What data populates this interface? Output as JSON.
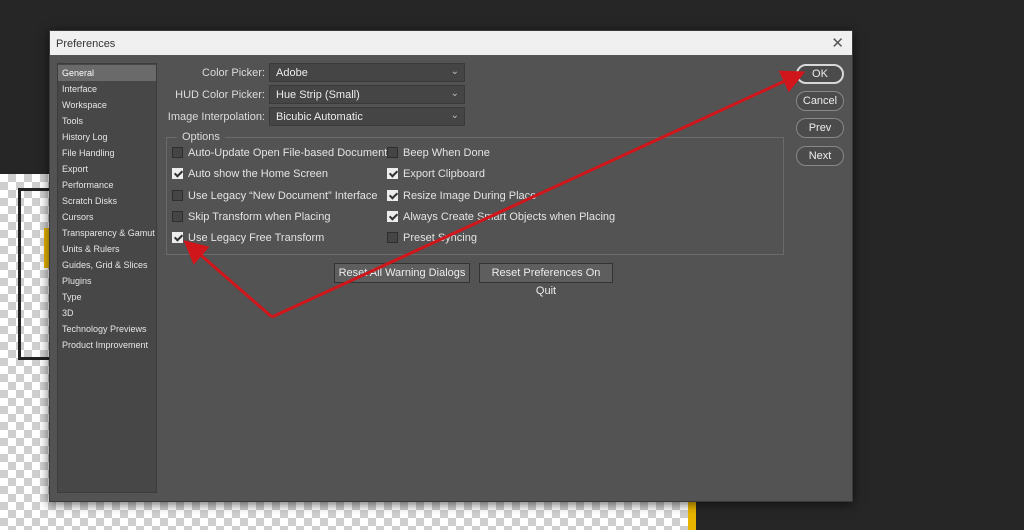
{
  "window": {
    "title": "Preferences"
  },
  "sidebar": {
    "items": [
      {
        "label": "General"
      },
      {
        "label": "Interface"
      },
      {
        "label": "Workspace"
      },
      {
        "label": "Tools"
      },
      {
        "label": "History Log"
      },
      {
        "label": "File Handling"
      },
      {
        "label": "Export"
      },
      {
        "label": "Performance"
      },
      {
        "label": "Scratch Disks"
      },
      {
        "label": "Cursors"
      },
      {
        "label": "Transparency & Gamut"
      },
      {
        "label": "Units & Rulers"
      },
      {
        "label": "Guides, Grid & Slices"
      },
      {
        "label": "Plugins"
      },
      {
        "label": "Type"
      },
      {
        "label": "3D"
      },
      {
        "label": "Technology Previews"
      },
      {
        "label": "Product Improvement"
      }
    ]
  },
  "fields": {
    "color_picker": {
      "label": "Color Picker:",
      "value": "Adobe"
    },
    "hud_color_picker": {
      "label": "HUD Color Picker:",
      "value": "Hue Strip (Small)"
    },
    "image_interpolation": {
      "label": "Image Interpolation:",
      "value": "Bicubic Automatic"
    }
  },
  "options": {
    "legend": "Options",
    "left": [
      {
        "label": "Auto-Update Open File-based Documents",
        "checked": false
      },
      {
        "label": "Auto show the Home Screen",
        "checked": true
      },
      {
        "label": "Use Legacy “New Document” Interface",
        "checked": false
      },
      {
        "label": "Skip Transform when Placing",
        "checked": false
      },
      {
        "label": "Use Legacy Free Transform",
        "checked": true
      }
    ],
    "right": [
      {
        "label": "Beep When Done",
        "checked": false
      },
      {
        "label": "Export Clipboard",
        "checked": true
      },
      {
        "label": "Resize Image During Place",
        "checked": true
      },
      {
        "label": "Always Create Smart Objects when Placing",
        "checked": true
      },
      {
        "label": "Preset Syncing",
        "checked": false
      }
    ]
  },
  "buttons": {
    "reset_warning": "Reset All Warning Dialogs",
    "reset_prefs": "Reset Preferences On Quit",
    "ok": "OK",
    "cancel": "Cancel",
    "prev": "Prev",
    "next": "Next"
  },
  "colors": {
    "annotation": "#d0161b",
    "dialog_bg": "#535353",
    "sidebar_bg": "#474747"
  }
}
